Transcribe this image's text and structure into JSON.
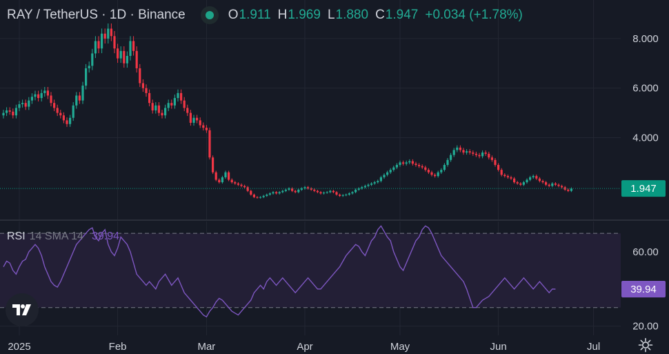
{
  "header": {
    "symbol": "RAY / TetherUS · 1D · Binance",
    "open_label": "O",
    "open": "1.911",
    "high_label": "H",
    "high": "1.969",
    "low_label": "L",
    "low": "1.880",
    "close_label": "C",
    "close": "1.947",
    "change": "+0.034 (+1.78%)",
    "status_color": "#1ea489"
  },
  "rsi_legend": {
    "name": "RSI",
    "params": "14 SMA 14",
    "value": "39.94"
  },
  "colors": {
    "up": "#22ab94",
    "down": "#f23645",
    "rsi_line": "#7e57c2",
    "rsi_band": "#231f36",
    "price_label_bg": "#089981",
    "rsi_label_bg": "#7e57c2",
    "background": "#161a25",
    "grid": "#232733",
    "axis_text": "#d1d4dc"
  },
  "icons": {
    "logo": "tradingview-logo-icon",
    "settings": "gear-icon"
  },
  "chart_data": [
    {
      "type": "candlestick",
      "title": "RAY / TetherUS · 1D · Binance",
      "x_tick_labels": [
        "2025",
        "Feb",
        "Mar",
        "Apr",
        "May",
        "Jun",
        "Jul"
      ],
      "x_tick_dates": [
        "2025-01-01",
        "2025-02-01",
        "2025-03-01",
        "2025-04-01",
        "2025-05-01",
        "2025-06-01",
        "2025-07-01"
      ],
      "y_tick_labels": [
        "8.000",
        "6.000",
        "4.000"
      ],
      "y_ticks": [
        8.0,
        6.0,
        4.0
      ],
      "ylim": [
        1.2,
        9.0
      ],
      "last_price_label": "1.947",
      "last_price": 1.947,
      "grid": true,
      "note": "close values approximate (read visually), one per day",
      "start_date": "2024-12-27",
      "close": [
        5.0,
        5.1,
        5.05,
        4.9,
        5.2,
        5.35,
        5.4,
        5.25,
        5.5,
        5.65,
        5.75,
        5.6,
        5.8,
        5.9,
        5.7,
        5.4,
        5.2,
        5.0,
        4.9,
        4.7,
        4.55,
        4.8,
        5.3,
        5.7,
        5.5,
        6.1,
        6.8,
        6.9,
        7.4,
        7.9,
        7.6,
        8.2,
        8.0,
        8.4,
        8.1,
        7.6,
        7.2,
        7.5,
        7.0,
        7.3,
        7.9,
        7.5,
        6.8,
        6.2,
        6.0,
        5.8,
        5.4,
        5.1,
        5.3,
        5.0,
        4.9,
        5.2,
        5.4,
        5.3,
        5.6,
        5.8,
        5.5,
        5.2,
        5.0,
        4.6,
        4.8,
        4.7,
        4.5,
        4.4,
        4.3,
        3.2,
        2.6,
        2.3,
        2.2,
        2.4,
        2.6,
        2.3,
        2.2,
        2.15,
        2.1,
        2.05,
        2.0,
        1.85,
        1.7,
        1.6,
        1.58,
        1.6,
        1.65,
        1.7,
        1.75,
        1.8,
        1.75,
        1.8,
        1.85,
        1.9,
        1.95,
        1.85,
        1.8,
        1.9,
        1.95,
        2.0,
        1.95,
        1.9,
        1.85,
        1.8,
        1.75,
        1.78,
        1.8,
        1.85,
        1.8,
        1.7,
        1.65,
        1.68,
        1.7,
        1.75,
        1.8,
        1.9,
        1.95,
        2.0,
        2.05,
        2.1,
        2.15,
        2.2,
        2.25,
        2.4,
        2.5,
        2.6,
        2.7,
        2.8,
        2.9,
        3.0,
        2.95,
        3.0,
        3.05,
        2.95,
        2.9,
        2.85,
        2.8,
        2.7,
        2.6,
        2.5,
        2.45,
        2.6,
        2.7,
        2.9,
        3.1,
        3.3,
        3.5,
        3.6,
        3.5,
        3.4,
        3.45,
        3.4,
        3.35,
        3.3,
        3.25,
        3.4,
        3.35,
        3.2,
        3.1,
        2.9,
        2.7,
        2.5,
        2.45,
        2.4,
        2.35,
        2.2,
        2.15,
        2.1,
        2.2,
        2.3,
        2.4,
        2.45,
        2.35,
        2.25,
        2.2,
        2.1,
        2.05,
        2.15,
        2.1,
        2.05,
        2.0,
        1.9,
        1.85,
        1.947
      ]
    },
    {
      "type": "line",
      "title": "RSI 14 SMA 14",
      "y_tick_labels": [
        "60.00",
        "20.00"
      ],
      "y_ticks": [
        60,
        20
      ],
      "ylim": [
        18,
        76
      ],
      "band": [
        30,
        70
      ],
      "last_value_label": "39.94",
      "last_value": 39.94,
      "note": "RSI values approximate (read visually), aligned with candle dates",
      "series": [
        {
          "values": [
            52,
            55,
            54,
            50,
            48,
            52,
            55,
            56,
            60,
            62,
            64,
            62,
            58,
            52,
            48,
            44,
            42,
            41,
            44,
            48,
            52,
            56,
            60,
            64,
            66,
            68,
            70,
            72,
            73,
            68,
            66,
            70,
            72,
            64,
            60,
            58,
            62,
            68,
            66,
            64,
            60,
            54,
            48,
            46,
            44,
            42,
            44,
            42,
            40,
            44,
            46,
            48,
            45,
            42,
            44,
            46,
            42,
            38,
            36,
            34,
            32,
            30,
            28,
            26,
            25,
            28,
            30,
            33,
            35,
            34,
            32,
            30,
            28,
            27,
            26,
            28,
            30,
            32,
            34,
            38,
            40,
            42,
            40,
            44,
            46,
            44,
            42,
            44,
            46,
            44,
            42,
            40,
            38,
            40,
            42,
            44,
            46,
            44,
            42,
            40,
            40,
            42,
            44,
            46,
            48,
            50,
            52,
            55,
            58,
            60,
            62,
            64,
            63,
            60,
            58,
            62,
            66,
            68,
            72,
            74,
            71,
            68,
            66,
            60,
            56,
            52,
            50,
            54,
            58,
            62,
            66,
            68,
            72,
            74,
            73,
            70,
            66,
            62,
            58,
            56,
            54,
            52,
            50,
            48,
            46,
            44,
            40,
            35,
            30,
            30,
            32,
            34,
            35,
            36,
            38,
            40,
            42,
            44,
            46,
            44,
            42,
            40,
            42,
            44,
            46,
            44,
            42,
            40,
            42,
            44,
            42,
            40,
            38,
            40,
            39.94
          ]
        }
      ]
    }
  ]
}
